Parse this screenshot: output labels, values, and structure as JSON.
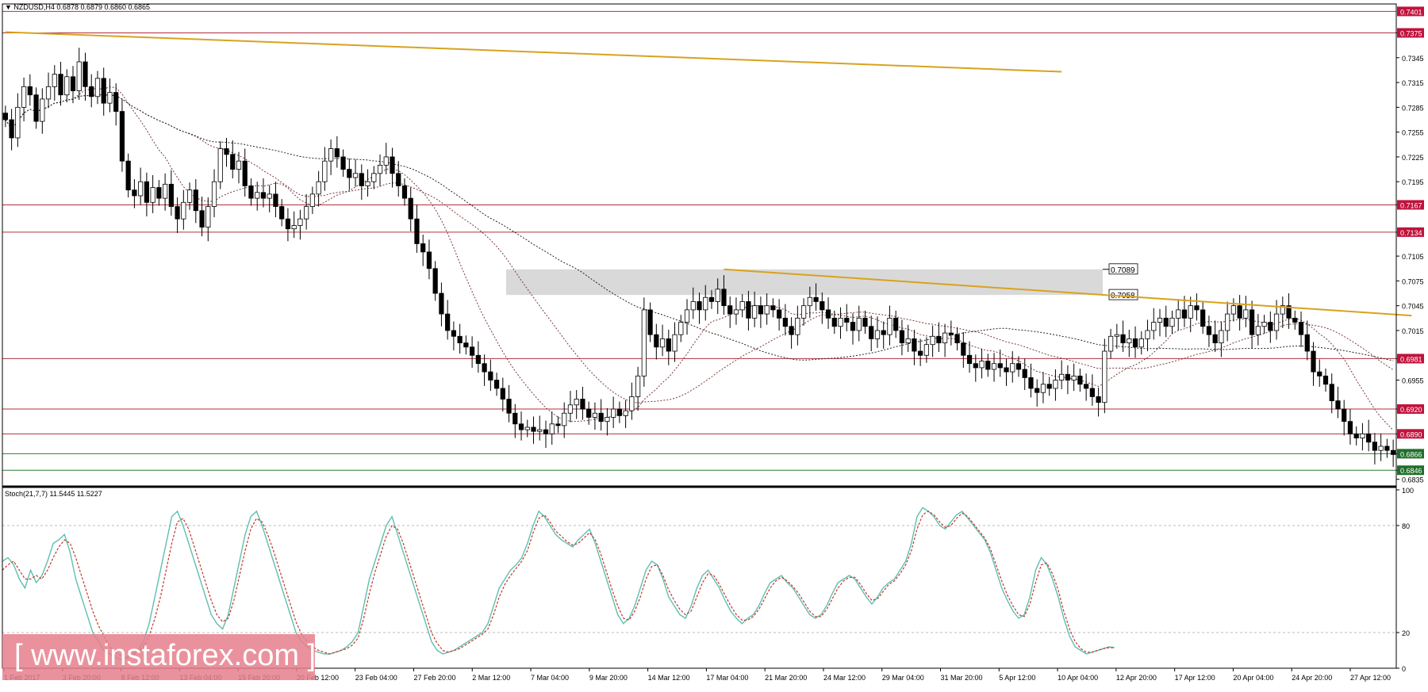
{
  "header": {
    "symbol_info": "NZDUSD,H4  0.6878 0.6879 0.6860 0.6865"
  },
  "stoch_header": "Stoch(21,7,7) 11.5445 11.5227",
  "watermark": "[ www.instaforex.com ]",
  "colors": {
    "candle": "#000000",
    "resistance_line": "#b03040",
    "support_line": "#2e7d32",
    "trendline": "#d8a21e",
    "zone": "#d9d9d9",
    "stoch_main": "#5fbfb0",
    "stoch_signal": "#c0392b",
    "price_tag_red": "#c0123c",
    "price_tag_green": "#1f6f2a"
  },
  "chart_data": [
    {
      "type": "candlestick",
      "title": "NZDUSD,H4",
      "ylim": [
        0.6828,
        0.741
      ],
      "price_axis_ticks": [
        "0.7375",
        "0.7345",
        "0.7315",
        "0.7285",
        "0.7255",
        "0.7225",
        "0.7195",
        "0.7167",
        "0.7134",
        "0.7105",
        "0.7075",
        "0.7045",
        "0.7015",
        "0.6981",
        "0.6955",
        "0.6920",
        "0.6890",
        "0.6866",
        "0.6846",
        "0.6835"
      ],
      "time_axis_labels": [
        "1 Feb 2017",
        "3 Feb 20:00",
        "8 Feb 12:00",
        "13 Feb 04:00",
        "15 Feb 20:00",
        "20 Feb 12:00",
        "23 Feb 04:00",
        "27 Feb 20:00",
        "2 Mar 12:00",
        "7 Mar 04:00",
        "9 Mar 20:00",
        "14 Mar 12:00",
        "17 Mar 04:00",
        "21 Mar 20:00",
        "24 Mar 12:00",
        "29 Mar 04:00",
        "31 Mar 20:00",
        "5 Apr 12:00",
        "10 Apr 04:00",
        "12 Apr 20:00",
        "17 Apr 12:00",
        "20 Apr 04:00",
        "24 Apr 20:00",
        "27 Apr 12:00"
      ],
      "horizontal_levels": [
        {
          "value": 0.7401,
          "label": "0.7401",
          "kind": "resistance"
        },
        {
          "value": 0.7375,
          "label": "0.7375",
          "kind": "resistance"
        },
        {
          "value": 0.7167,
          "label": "0.7167",
          "kind": "resistance"
        },
        {
          "value": 0.7134,
          "label": "0.7134",
          "kind": "resistance"
        },
        {
          "value": 0.6981,
          "label": "0.6981",
          "kind": "resistance"
        },
        {
          "value": 0.692,
          "label": "0.6920",
          "kind": "resistance"
        },
        {
          "value": 0.689,
          "label": "0.6890",
          "kind": "resistance"
        },
        {
          "value": 0.6866,
          "label": "0.6866",
          "kind": "support"
        },
        {
          "value": 0.6846,
          "label": "0.6846",
          "kind": "support"
        }
      ],
      "zone": {
        "low": 0.7058,
        "high": 0.7089,
        "labels": [
          "0.7089",
          "0.7058"
        ]
      },
      "trendlines": [
        {
          "from": {
            "bar": 0,
            "price": 0.7376
          },
          "to": {
            "bar": 172,
            "price": 0.7328
          }
        },
        {
          "from": {
            "bar": 117,
            "price": 0.7089
          },
          "to": {
            "bar": 229,
            "price": 0.7033
          }
        }
      ],
      "closes": [
        0.727,
        0.7248,
        0.7285,
        0.731,
        0.73,
        0.7268,
        0.7295,
        0.731,
        0.7325,
        0.73,
        0.7322,
        0.7305,
        0.734,
        0.731,
        0.7298,
        0.732,
        0.729,
        0.7303,
        0.728,
        0.722,
        0.7185,
        0.7178,
        0.7195,
        0.717,
        0.7188,
        0.7175,
        0.7192,
        0.7165,
        0.715,
        0.717,
        0.7185,
        0.716,
        0.714,
        0.7165,
        0.7195,
        0.7235,
        0.7228,
        0.721,
        0.722,
        0.719,
        0.7175,
        0.7182,
        0.7175,
        0.718,
        0.7165,
        0.715,
        0.7138,
        0.7142,
        0.715,
        0.7165,
        0.718,
        0.7195,
        0.722,
        0.7235,
        0.7225,
        0.721,
        0.72,
        0.7205,
        0.719,
        0.7195,
        0.7205,
        0.7215,
        0.7225,
        0.7205,
        0.719,
        0.7175,
        0.715,
        0.712,
        0.711,
        0.709,
        0.706,
        0.7035,
        0.7015,
        0.7008,
        0.7,
        0.6995,
        0.6985,
        0.6975,
        0.6965,
        0.6955,
        0.6945,
        0.6932,
        0.6915,
        0.6902,
        0.6895,
        0.6898,
        0.6893,
        0.6895,
        0.689,
        0.6902,
        0.69,
        0.6915,
        0.6925,
        0.6932,
        0.692,
        0.691,
        0.6915,
        0.6905,
        0.691,
        0.692,
        0.6912,
        0.6918,
        0.6935,
        0.696,
        0.704,
        0.701,
        0.6995,
        0.7005,
        0.699,
        0.701,
        0.7025,
        0.704,
        0.705,
        0.704,
        0.7055,
        0.705,
        0.7065,
        0.7045,
        0.7035,
        0.704,
        0.705,
        0.703,
        0.7045,
        0.7035,
        0.7045,
        0.704,
        0.703,
        0.702,
        0.701,
        0.703,
        0.7045,
        0.7055,
        0.705,
        0.704,
        0.703,
        0.702,
        0.703,
        0.7025,
        0.7015,
        0.703,
        0.702,
        0.7005,
        0.7015,
        0.701,
        0.703,
        0.7015,
        0.7,
        0.7005,
        0.699,
        0.6985,
        0.6998,
        0.7008,
        0.7,
        0.7012,
        0.701,
        0.7,
        0.6985,
        0.6975,
        0.697,
        0.6978,
        0.6968,
        0.6975,
        0.697,
        0.6965,
        0.6975,
        0.6968,
        0.6958,
        0.6945,
        0.694,
        0.695,
        0.6945,
        0.6955,
        0.6962,
        0.6955,
        0.696,
        0.695,
        0.6945,
        0.6935,
        0.6928,
        0.699,
        0.7008,
        0.701,
        0.7,
        0.7005,
        0.6995,
        0.7005,
        0.7015,
        0.7025,
        0.703,
        0.702,
        0.703,
        0.704,
        0.703,
        0.7045,
        0.704,
        0.702,
        0.701,
        0.7,
        0.7015,
        0.7035,
        0.7045,
        0.703,
        0.704,
        0.701,
        0.702,
        0.7025,
        0.7015,
        0.7035,
        0.7045,
        0.703,
        0.7025,
        0.701,
        0.699,
        0.6965,
        0.696,
        0.695,
        0.693,
        0.692,
        0.6905,
        0.689,
        0.6885,
        0.689,
        0.688,
        0.687,
        0.6875,
        0.687,
        0.6865
      ]
    },
    {
      "type": "line",
      "title": "Stoch(21,7,7) 11.5445 11.5227",
      "ylim": [
        0,
        100
      ],
      "y_ticks": [
        "100",
        "80",
        "20",
        "0"
      ],
      "levels": [
        80,
        20
      ],
      "series": [
        {
          "values": [
            60,
            62,
            58,
            50,
            45,
            55,
            48,
            52,
            60,
            70,
            72,
            75,
            65,
            50,
            40,
            30,
            20,
            15,
            10,
            8,
            6,
            5,
            6,
            8,
            10,
            15,
            25,
            40,
            55,
            70,
            85,
            88,
            80,
            70,
            60,
            50,
            40,
            30,
            25,
            22,
            30,
            45,
            60,
            75,
            85,
            88,
            80,
            70,
            60,
            50,
            40,
            30,
            20,
            15,
            12,
            10,
            9,
            8,
            8,
            9,
            10,
            12,
            15,
            20,
            35,
            50,
            60,
            70,
            80,
            85,
            75,
            65,
            55,
            45,
            35,
            25,
            15,
            10,
            8,
            9,
            10,
            12,
            14,
            16,
            18,
            20,
            25,
            35,
            45,
            50,
            55,
            58,
            62,
            70,
            80,
            88,
            85,
            80,
            75,
            72,
            70,
            68,
            72,
            75,
            78,
            70,
            60,
            50,
            40,
            30,
            25,
            28,
            35,
            45,
            55,
            60,
            58,
            50,
            40,
            35,
            30,
            28,
            35,
            45,
            52,
            55,
            50,
            45,
            38,
            32,
            28,
            25,
            28,
            30,
            35,
            42,
            48,
            50,
            52,
            48,
            45,
            40,
            35,
            30,
            28,
            30,
            35,
            42,
            48,
            50,
            52,
            50,
            45,
            40,
            36,
            40,
            45,
            48,
            50,
            55,
            60,
            70,
            85,
            90,
            88,
            85,
            80,
            78,
            82,
            86,
            88,
            84,
            80,
            76,
            72,
            65,
            55,
            45,
            38,
            32,
            28,
            30,
            40,
            55,
            62,
            58,
            50,
            40,
            28,
            18,
            12,
            10,
            8,
            9,
            10,
            11,
            12,
            11.5
          ]
        },
        {
          "values": [
            55,
            58,
            60,
            55,
            50,
            50,
            52,
            50,
            55,
            62,
            68,
            72,
            70,
            62,
            52,
            42,
            32,
            24,
            18,
            12,
            9,
            7,
            6,
            7,
            9,
            12,
            18,
            28,
            40,
            55,
            70,
            82,
            84,
            78,
            68,
            58,
            48,
            38,
            30,
            26,
            28,
            38,
            52,
            66,
            78,
            84,
            82,
            75,
            66,
            56,
            46,
            36,
            26,
            19,
            15,
            12,
            10,
            9,
            8,
            9,
            10,
            11,
            13,
            17,
            28,
            42,
            54,
            64,
            74,
            80,
            78,
            70,
            60,
            50,
            40,
            30,
            20,
            14,
            10,
            9,
            10,
            11,
            13,
            15,
            17,
            19,
            22,
            30,
            40,
            47,
            52,
            56,
            60,
            66,
            76,
            84,
            86,
            82,
            77,
            74,
            71,
            69,
            70,
            73,
            76,
            72,
            64,
            54,
            44,
            35,
            28,
            27,
            32,
            40,
            50,
            57,
            58,
            52,
            44,
            38,
            33,
            30,
            32,
            40,
            48,
            53,
            52,
            47,
            41,
            35,
            30,
            27,
            27,
            29,
            33,
            39,
            45,
            49,
            51,
            49,
            46,
            42,
            37,
            32,
            29,
            29,
            33,
            39,
            45,
            49,
            51,
            51,
            47,
            42,
            38,
            39,
            43,
            47,
            49,
            53,
            58,
            66,
            78,
            86,
            88,
            86,
            82,
            79,
            80,
            84,
            87,
            85,
            81,
            77,
            73,
            67,
            58,
            49,
            41,
            35,
            30,
            29,
            36,
            48,
            58,
            59,
            53,
            44,
            32,
            22,
            15,
            11,
            9,
            9,
            10,
            11,
            11.5,
            11.5
          ]
        }
      ]
    }
  ]
}
